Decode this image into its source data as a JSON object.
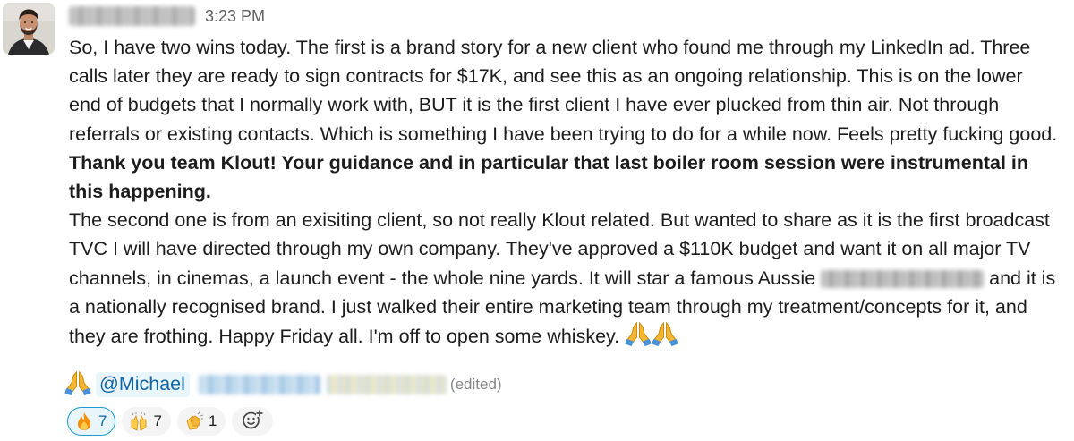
{
  "message": {
    "timestamp": "3:23 PM",
    "paragraph1_regular": "So, I have two wins today. The first is a brand story for a new client who found me through my LinkedIn ad. Three calls later they are ready to sign contracts for $17K, and see this as an ongoing relationship. This is on the lower end of budgets that I normally work with, BUT it is the first client I have ever plucked from thin air. Not through referrals or existing contacts. Which is something I have been trying to do for a while now. Feels pretty fucking good. ",
    "paragraph1_bold": "Thank you team Klout! Your guidance and in particular that last boiler room session were instrumental in this happening.",
    "paragraph2_part1": "The second one is from an exisiting client, so not really Klout related. But wanted to share as it is the first broadcast TVC I will have directed through my own company. They've approved a $110K budget and want it on all major TV channels, in cinemas, a launch event - the whole nine yards. It will star a famous Aussie ",
    "paragraph2_part2": " and it is a nationally recognised brand. I just walked their entire marketing team through my treatment/concepts for it, and they are frothing. Happy Friday all. I'm off to open some whiskey. ",
    "mention": "@Michael",
    "edited_label": "(edited)"
  },
  "reactions": [
    {
      "icon": "fire-icon",
      "count": "7",
      "active": true
    },
    {
      "icon": "raised-hands-icon",
      "count": "7",
      "active": false
    },
    {
      "icon": "clapping-hands-icon",
      "count": "1",
      "active": false
    }
  ],
  "colors": {
    "mention_bg": "#e8f5fa",
    "mention_text": "#1264a3",
    "active_reaction_border": "#1d9bd1",
    "timestamp": "#616061",
    "text": "#1d1c1d"
  }
}
